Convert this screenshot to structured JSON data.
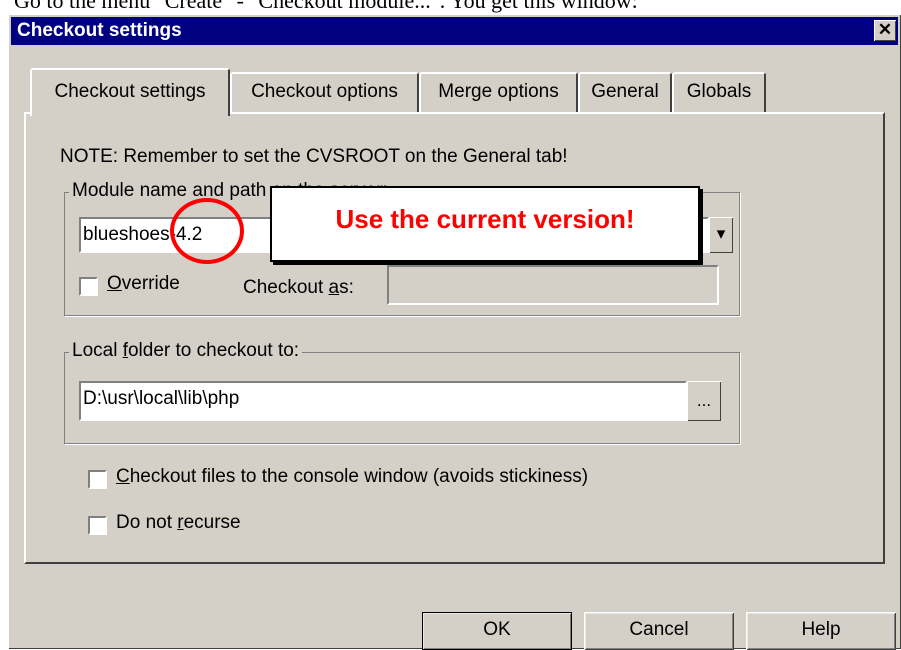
{
  "intro_text": "Go to the menu \"Create\" - \"Checkout module...\". You get this window:",
  "dialog": {
    "title": "Checkout settings",
    "close_icon": "✕",
    "tabs": [
      "Checkout settings",
      "Checkout options",
      "Merge options",
      "General",
      "Globals"
    ],
    "active_tab": "Checkout settings"
  },
  "panel": {
    "note": "NOTE: Remember to set the CVSROOT on the General tab!",
    "module_group": {
      "legend": "Module name and path on the server:",
      "module_value": "blueshoes-4.2",
      "override_label_u": "O",
      "override_label_rest": "verride",
      "override_checked": false,
      "checkout_as_prefix": "Checkout ",
      "checkout_as_u": "a",
      "checkout_as_rest": "s:",
      "checkout_as_value": ""
    },
    "local_group": {
      "legend_prefix": "Local ",
      "legend_u": "f",
      "legend_rest": "older to checkout to:",
      "folder_value": "D:\\usr\\local\\lib\\php",
      "browse_label": "..."
    },
    "options": {
      "console_u": "C",
      "console_rest": "heckout files to the console window (avoids stickiness)",
      "console_checked": false,
      "recurse_prefix": "Do not ",
      "recurse_u": "r",
      "recurse_rest": "ecurse",
      "recurse_checked": false
    }
  },
  "buttons": {
    "ok": "OK",
    "cancel": "Cancel",
    "help": "Help"
  },
  "annotation": {
    "callout_text": "Use the current version!",
    "color": "#ff0000"
  },
  "colors": {
    "title_bar": "#000080",
    "face": "#d4d0c8"
  }
}
